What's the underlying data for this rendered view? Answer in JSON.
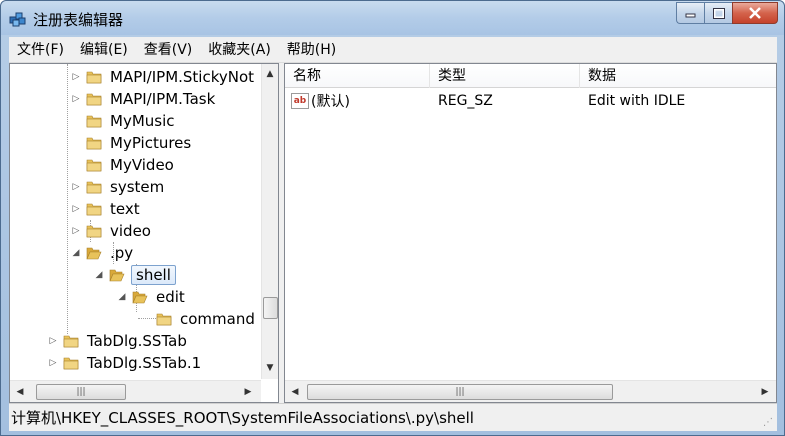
{
  "window": {
    "title": "注册表编辑器"
  },
  "menu": [
    "文件(F)",
    "编辑(E)",
    "查看(V)",
    "收藏夹(A)",
    "帮助(H)"
  ],
  "tree": {
    "items": [
      {
        "label": "MAPI/IPM.StickyNot",
        "expander": "closed"
      },
      {
        "label": "MAPI/IPM.Task",
        "expander": "closed"
      },
      {
        "label": "MyMusic",
        "expander": "none"
      },
      {
        "label": "MyPictures",
        "expander": "none"
      },
      {
        "label": "MyVideo",
        "expander": "none"
      },
      {
        "label": "system",
        "expander": "closed"
      },
      {
        "label": "text",
        "expander": "closed"
      },
      {
        "label": "video",
        "expander": "closed"
      },
      {
        "label": ".py",
        "expander": "open"
      },
      {
        "label": "shell",
        "expander": "open"
      },
      {
        "label": "edit",
        "expander": "open"
      },
      {
        "label": "command",
        "expander": "none"
      },
      {
        "label": "TabDlg.SSTab",
        "expander": "closed"
      },
      {
        "label": "TabDlg.SSTab.1",
        "expander": "closed"
      }
    ]
  },
  "list": {
    "columns": [
      "名称",
      "类型",
      "数据"
    ],
    "rows": [
      {
        "name": "(默认)",
        "type": "REG_SZ",
        "data": "Edit with IDLE",
        "icon": "string-value-icon"
      }
    ]
  },
  "status": {
    "path": "计算机\\HKEY_CLASSES_ROOT\\SystemFileAssociations\\.py\\shell"
  },
  "colors": {
    "folder": "#e8c25a",
    "selection_border": "#7da2ce",
    "title_bar": "#b3cce8"
  }
}
